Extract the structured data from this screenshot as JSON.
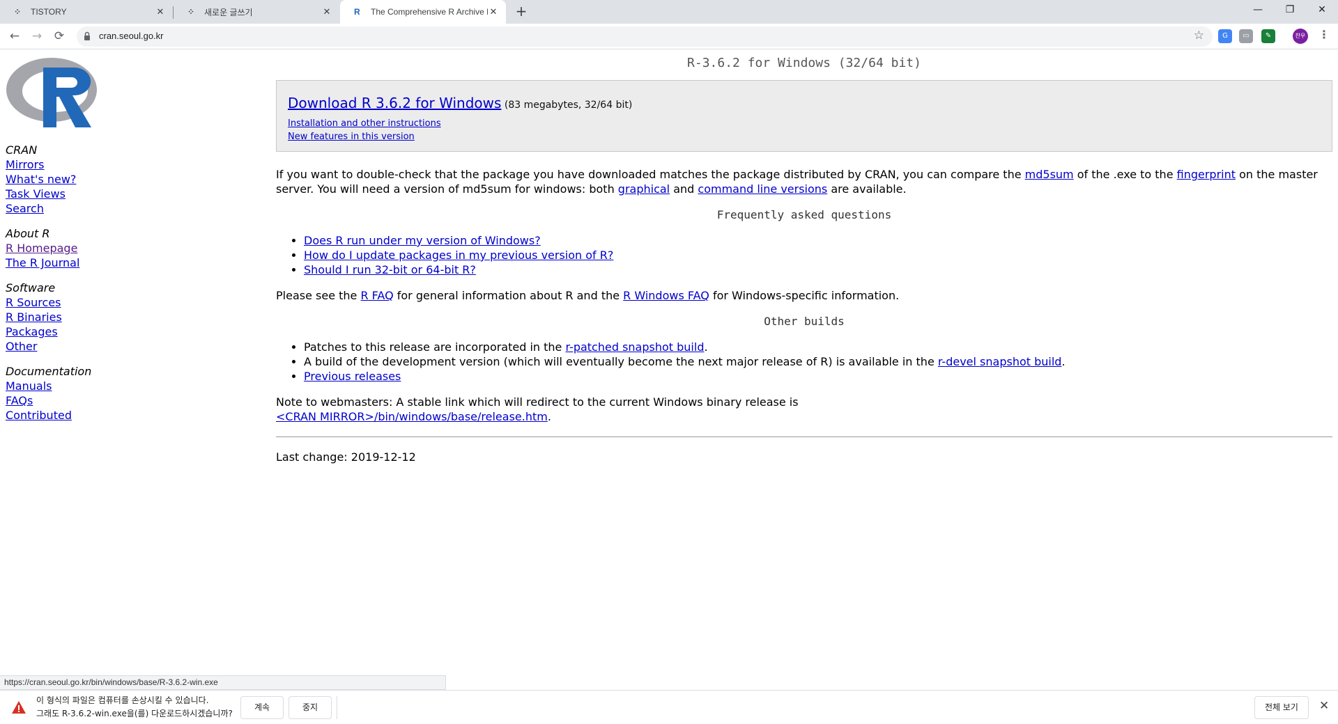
{
  "browser": {
    "tabs": [
      {
        "icon": "tistory-icon",
        "glyph": "⁘",
        "label": "TISTORY",
        "active": false
      },
      {
        "icon": "tistory-icon",
        "glyph": "⁘",
        "label": "새로운 글쓰기",
        "active": false
      },
      {
        "icon": "r-favicon-icon",
        "glyph": "R",
        "label": "The Comprehensive R Archive N",
        "active": true
      }
    ],
    "new_tab": "+",
    "url": "cran.seoul.go.kr",
    "avatar_text": "찬우",
    "window_controls": {
      "minimize": "—",
      "restore": "❐",
      "close": "✕"
    }
  },
  "sidebar": {
    "sections": [
      {
        "title": "CRAN",
        "links": [
          "Mirrors",
          "What's new?",
          "Task Views",
          "Search"
        ]
      },
      {
        "title": "About R",
        "links": [
          "R Homepage",
          "The R Journal"
        ]
      },
      {
        "title": "Software",
        "links": [
          "R Sources",
          "R Binaries",
          "Packages",
          "Other"
        ]
      },
      {
        "title": "Documentation",
        "links": [
          "Manuals",
          "FAQs",
          "Contributed"
        ]
      }
    ]
  },
  "main": {
    "title": "R-3.6.2 for Windows (32/64 bit)",
    "download": {
      "link": "Download R 3.6.2 for Windows",
      "meta": " (83 megabytes, 32/64 bit)",
      "install_link": "Installation and other instructions",
      "features_link": "New features in this version"
    },
    "md5": {
      "t1": "If you want to double-check that the package you have downloaded matches the package distributed by CRAN, you can compare the ",
      "l1": "md5sum",
      "t2": " of the .exe to the ",
      "l2": "fingerprint",
      "t3": " on the master server. You will need a version of md5sum for windows: both ",
      "l3": "graphical",
      "t4": " and ",
      "l4": "command line versions",
      "t5": " are available."
    },
    "faq_heading": "Frequently asked questions",
    "faq_items": [
      "Does R run under my version of Windows?",
      "How do I update packages in my previous version of R?",
      "Should I run 32-bit or 64-bit R?"
    ],
    "see": {
      "t1": "Please see the ",
      "l1": "R FAQ",
      "t2": " for general information about R and the ",
      "l2": "R Windows FAQ",
      "t3": " for Windows-specific information."
    },
    "builds_heading": "Other builds",
    "builds": {
      "b1_text": "Patches to this release are incorporated in the ",
      "b1_link": "r-patched snapshot build",
      "b1_end": ".",
      "b2_text": "A build of the development version (which will eventually become the next major release of R) is available in the ",
      "b2_link": "r-devel snapshot build",
      "b2_end": ".",
      "b3_link": "Previous releases"
    },
    "note": {
      "text": "Note to webmasters: A stable link which will redirect to the current Windows binary release is",
      "link": "<CRAN MIRROR>/bin/windows/base/release.htm",
      "end": "."
    },
    "last_change": "Last change: 2019-12-12"
  },
  "status_url": "https://cran.seoul.go.kr/bin/windows/base/R-3.6.2-win.exe",
  "download_bar": {
    "warning_line1": "이 형식의 파일은 컴퓨터를 손상시킬 수 있습니다.",
    "warning_line2": "그래도 R-3.6.2-win.exe을(를) 다운로드하시겠습니까?",
    "continue": "계속",
    "cancel": "중지",
    "show_all": "전체 보기",
    "close": "✕"
  },
  "colors": {
    "link": "#0000cc",
    "visited": "#551a8b",
    "r_blue": "#2268b8",
    "r_gray": "#9a9ca2",
    "avatar": "#7b1fa2",
    "warning": "#d93025"
  }
}
